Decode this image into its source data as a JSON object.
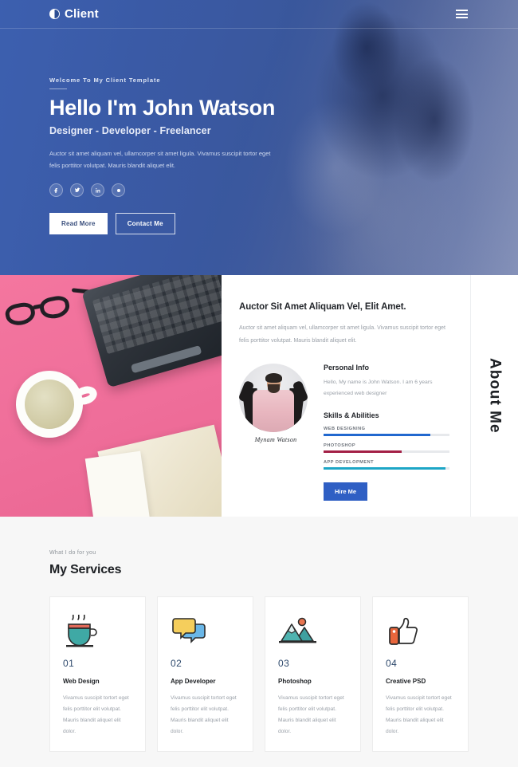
{
  "header": {
    "logo_text": "Client",
    "logo_icon": "contrast-circle-icon",
    "menu_icon": "hamburger-menu-icon"
  },
  "hero": {
    "welcome": "Welcome To My Client Template",
    "title": "Hello I'm John Watson",
    "subtitle": "Designer - Developer - Freelancer",
    "paragraph": "Auctor sit amet aliquam vel, ullamcorper sit amet ligula. Vivamus suscipit tortor eget felis porttitor volutpat. Mauris blandit aliquet elit.",
    "social": [
      {
        "name": "facebook-icon",
        "glyph": "f"
      },
      {
        "name": "twitter-icon",
        "glyph": "t"
      },
      {
        "name": "linkedin-icon",
        "glyph": "in"
      },
      {
        "name": "google-plus-icon",
        "glyph": "g"
      }
    ],
    "primary_button": "Read More",
    "secondary_button": "Contact Me",
    "overlay_color": "#3c5faf"
  },
  "about": {
    "section_label": "About Me",
    "heading": "Auctor Sit Amet Aliquam Vel, Elit Amet.",
    "paragraph": "Auctor sit amet aliquam vel, ullamcorper sit amet ligula. Vivamus suscipit tortor eget felis porttitor volutpat. Mauris blandit aliquet elit.",
    "personal_info_title": "Personal Info",
    "personal_info_text": "Hello, My name is John Watson. I am 6 years experienced web designer",
    "signature": "Mynam Watson",
    "skills_title": "Skills & Abilities",
    "skills": [
      {
        "label": "WEB DESIGNING",
        "value": 85,
        "color": "#2168cf"
      },
      {
        "label": "PHOTOSHOP",
        "value": 62,
        "color": "#a32046"
      },
      {
        "label": "APP DEVELOPMENT",
        "value": 97,
        "color": "#1da6c6"
      }
    ],
    "hire_button": "Hire Me"
  },
  "services": {
    "kicker": "What I do for you",
    "title": "My Services",
    "cards": [
      {
        "icon": "coffee-cup-icon",
        "number": "01",
        "name": "Web Design",
        "text": "Vivamus suscipit tortort eget felis porttitor elit volutpat. Mauris blandit aliquet elit dolor."
      },
      {
        "icon": "speech-bubbles-icon",
        "number": "02",
        "name": "App Developer",
        "text": "Vivamus suscipit tortort eget felis porttitor elit volutpat. Mauris blandit aliquet elit dolor."
      },
      {
        "icon": "mountain-landscape-icon",
        "number": "03",
        "name": "Photoshop",
        "text": "Vivamus suscipit tortort eget felis porttitor elit volutpat. Mauris blandit aliquet elit dolor."
      },
      {
        "icon": "thumbs-up-icon",
        "number": "04",
        "name": "Creative PSD",
        "text": "Vivamus suscipit tortort eget felis porttitor elit volutpat. Mauris blandit aliquet elit dolor."
      }
    ]
  }
}
